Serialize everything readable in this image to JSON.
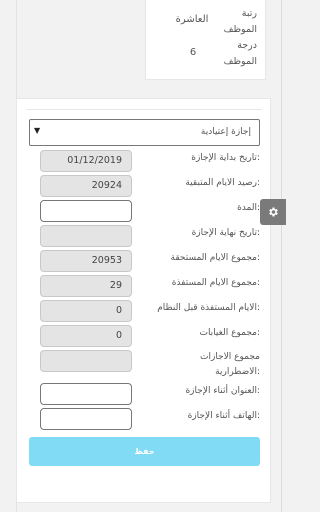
{
  "employee_info": {
    "rank_label": "رتبة الموظف",
    "rank_value": "العاشرة",
    "grade_label": "درجة الموظف",
    "grade_value": "6"
  },
  "leave_form": {
    "leave_type_selected": "إجازة إعتيادية",
    "fields": [
      {
        "label": "تاريخ بداية الإجازة:",
        "value": "01/12/2019"
      },
      {
        "label": "رصيد الايام المتبقية:",
        "value": "20924"
      },
      {
        "label": "المدة:",
        "value": ""
      },
      {
        "label": "تاريخ نهاية الإجازة:",
        "value": ""
      },
      {
        "label": "مجموع الايام المستحقة:",
        "value": "20953"
      },
      {
        "label": "مجموع الايام المستفذة:",
        "value": "29"
      },
      {
        "label": "الايام المستفذة قبل النظام:",
        "value": "0"
      },
      {
        "label": "مجموع الغيابات:",
        "value": "0"
      },
      {
        "label": "مجموع الاجازات الاضطرارية:",
        "value": ""
      },
      {
        "label": "العنوان أثناء الإجازة:",
        "value": ""
      },
      {
        "label": "الهاتف أثناء الإجازة:",
        "value": ""
      }
    ],
    "save_label": "حفظ"
  },
  "settings_tab": {
    "icon": "gear-icon"
  },
  "colors": {
    "save_button": "#82dbf5",
    "readonly_field": "#e4e4e4",
    "gear_tab": "#7a7a7a"
  }
}
